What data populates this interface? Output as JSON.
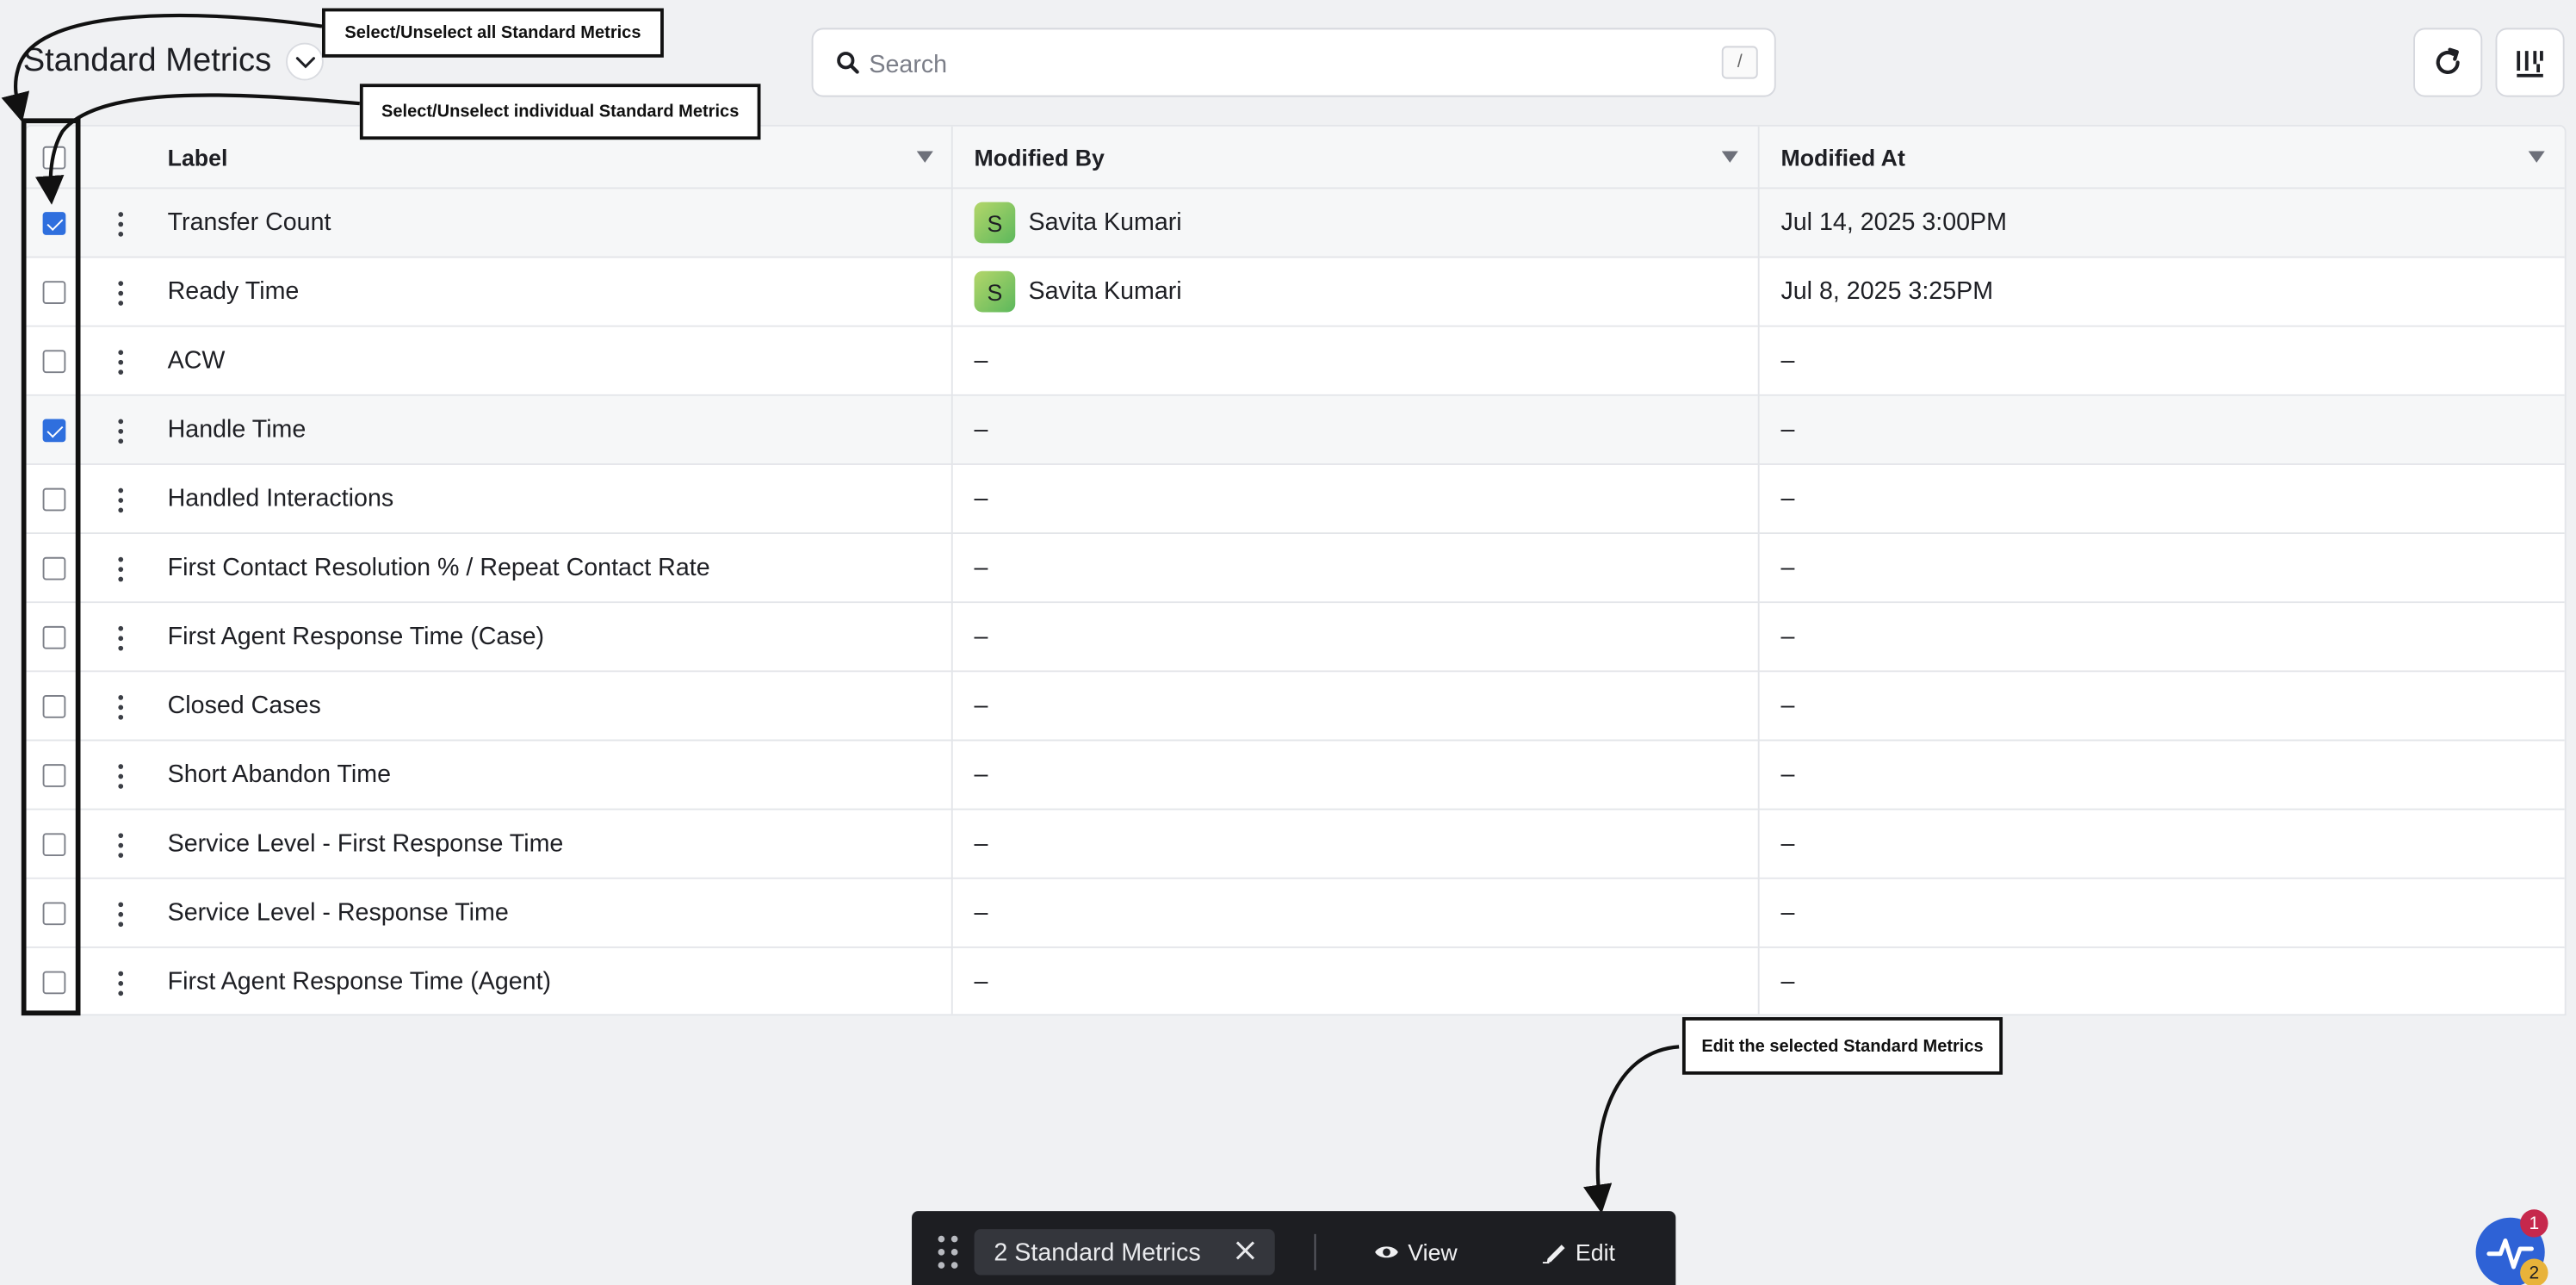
{
  "header": {
    "title": "Standard Metrics",
    "search_placeholder": "Search",
    "search_shortcut": "/"
  },
  "table": {
    "columns": {
      "label": "Label",
      "modified_by": "Modified By",
      "modified_at": "Modified At"
    },
    "rows": [
      {
        "label": "Transfer Count",
        "selected": true,
        "modified_by": "Savita Kumari",
        "avatar": "S",
        "modified_at": "Jul 14, 2025 3:00PM"
      },
      {
        "label": "Ready Time",
        "selected": false,
        "modified_by": "Savita Kumari",
        "avatar": "S",
        "modified_at": "Jul 8, 2025 3:25PM"
      },
      {
        "label": "ACW",
        "selected": false,
        "modified_by": "–",
        "modified_at": "–"
      },
      {
        "label": "Handle Time",
        "selected": true,
        "modified_by": "–",
        "modified_at": "–"
      },
      {
        "label": "Handled Interactions",
        "selected": false,
        "modified_by": "–",
        "modified_at": "–"
      },
      {
        "label": "First Contact Resolution % / Repeat Contact Rate",
        "selected": false,
        "modified_by": "–",
        "modified_at": "–"
      },
      {
        "label": "First Agent Response Time (Case)",
        "selected": false,
        "modified_by": "–",
        "modified_at": "–"
      },
      {
        "label": "Closed Cases",
        "selected": false,
        "modified_by": "–",
        "modified_at": "–"
      },
      {
        "label": "Short Abandon Time",
        "selected": false,
        "modified_by": "–",
        "modified_at": "–"
      },
      {
        "label": "Service Level - First Response Time",
        "selected": false,
        "modified_by": "–",
        "modified_at": "–"
      },
      {
        "label": "Service Level - Response Time",
        "selected": false,
        "modified_by": "–",
        "modified_at": "–"
      },
      {
        "label": "First Agent Response Time (Agent)",
        "selected": false,
        "modified_by": "–",
        "modified_at": "–"
      }
    ]
  },
  "annotations": {
    "select_all": "Select/Unselect all Standard Metrics",
    "select_individual": "Select/Unselect individual Standard Metrics",
    "edit_selected": "Edit the selected Standard Metrics"
  },
  "action_bar": {
    "selection_label": "2 Standard Metrics",
    "view_label": "View",
    "edit_label": "Edit"
  },
  "widget": {
    "badge_top": "1",
    "badge_bottom": "2"
  },
  "colors": {
    "accent": "#2f6fde",
    "action_bar": "#1d1e22",
    "badge_red": "#c6284c",
    "badge_yellow": "#e8b33a"
  }
}
